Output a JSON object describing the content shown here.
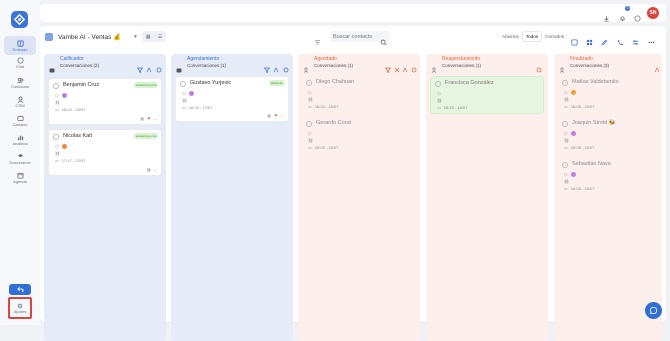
{
  "sidebar": {
    "items": [
      {
        "label": "Embudo",
        "icon": "funnel-icon"
      },
      {
        "label": "Chat",
        "icon": "chat-icon"
      },
      {
        "label": "Contactos",
        "icon": "contacts-icon"
      },
      {
        "label": "CRM",
        "icon": "crm-icon"
      },
      {
        "label": "Canales",
        "icon": "channels-icon"
      },
      {
        "label": "Analitica",
        "icon": "analytics-icon"
      },
      {
        "label": "Ecommerce",
        "icon": "ecommerce-icon"
      },
      {
        "label": "Agenda",
        "icon": "calendar-icon"
      }
    ],
    "settings_label": "Ajustes"
  },
  "topbar": {
    "notification_count": "3",
    "avatar_initials": "SN"
  },
  "board": {
    "selected": "Vambe AI - Ventas 💰",
    "search_placeholder": "Buscar contacto",
    "segments": [
      "Abiertos",
      "Todos",
      "Cerrados"
    ],
    "selected_segment": "Todos"
  },
  "columns": [
    {
      "title": "Calificador",
      "count": "Conversaciones (2)",
      "bg": "#e6ebf8",
      "title_color": "#3b73d9",
      "cards": [
        {
          "name": "Benjamin Cruz",
          "pill": "asistente por ia",
          "date": "18:02 - 24/07",
          "dot": "#c47be6",
          "tag_color": "#c47be6",
          "tag": "",
          "faded": false
        },
        {
          "name": "Nicolas Kalt",
          "pill": "asistente por ia",
          "date": "17:17 - 22/07",
          "dot": "#f08a3c",
          "tag_color": "#f08a3c",
          "tag": "",
          "faded": false
        }
      ]
    },
    {
      "title": "Agendamiento",
      "count": "Conversaciones (1)",
      "bg": "#e6ebf8",
      "title_color": "#3b73d9",
      "cards": [
        {
          "name": "Gustavo Yurjevic",
          "pill": "asistente",
          "date": "16:34 - 17/07",
          "dot": "#c47be6",
          "tag_color": "#c47be6",
          "tag": "",
          "faded": false
        }
      ]
    },
    {
      "title": "Agendado",
      "count": "Conversaciones (1)",
      "bg": "#fdf0ec",
      "title_color": "#e5673e",
      "cards": [
        {
          "name": "Diego Chahuan",
          "pill": "",
          "date": "16:24 - 16/07",
          "dot": "",
          "faded": true
        },
        {
          "name": "Gerardo Cood",
          "pill": "",
          "date": "16:02 - 16/07",
          "dot": "",
          "faded": true
        }
      ]
    },
    {
      "title": "Reagendamiento",
      "count": "Conversaciones (1)",
      "bg": "#fdf0ec",
      "title_color": "#e5673e",
      "cards": [
        {
          "name": "Francisca González",
          "pill": "",
          "date": "16:10 - 16/07",
          "dot": "",
          "faded": true,
          "green": true
        }
      ]
    },
    {
      "title": "Finalizado",
      "count": "Conversaciones (3)",
      "bg": "#fdf0ec",
      "title_color": "#e5673e",
      "cards": [
        {
          "name": "Matías Valdebenito",
          "pill": "",
          "date": "16:08 - 16/07",
          "dot": "#f0a23c",
          "faded": true
        },
        {
          "name": "Joaquin Strobl 🐝",
          "pill": "",
          "date": "16:08 - 16/07",
          "dot": "#c47be6",
          "faded": true
        },
        {
          "name": "Sebastián Nava",
          "pill": "",
          "date": "16:06 - 16/07",
          "dot": "#c47be6",
          "faded": true
        }
      ]
    }
  ]
}
